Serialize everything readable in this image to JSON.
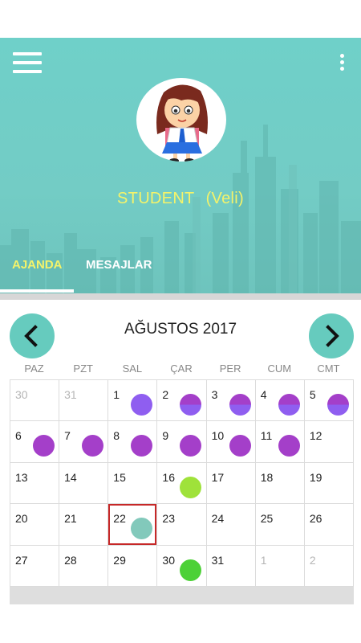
{
  "header": {
    "profile_name": "STUDENT",
    "profile_role": "(Veli)",
    "tabs": [
      {
        "label": "AJANDA",
        "active": true
      },
      {
        "label": "MESAJLAR",
        "active": false
      }
    ],
    "colors": {
      "header_bg": "#73ccc5",
      "accent_text": "#f4f36a"
    }
  },
  "calendar": {
    "month_title": "AĞUSTOS 2017",
    "prev_icon": "chevron-left-icon",
    "next_icon": "chevron-right-icon",
    "weekdays": [
      "PAZ",
      "PZT",
      "SAL",
      "ÇAR",
      "PER",
      "CUM",
      "CMT"
    ],
    "days": [
      {
        "n": "30",
        "muted": true
      },
      {
        "n": "31",
        "muted": true
      },
      {
        "n": "1",
        "dots": [
          "#8f5ef0"
        ]
      },
      {
        "n": "2",
        "dots": [
          "#a43fc9",
          "#8f5ef0"
        ]
      },
      {
        "n": "3",
        "dots": [
          "#a43fc9",
          "#8f5ef0"
        ]
      },
      {
        "n": "4",
        "dots": [
          "#a43fc9",
          "#8f5ef0"
        ]
      },
      {
        "n": "5",
        "dots": [
          "#a43fc9",
          "#8f5ef0"
        ]
      },
      {
        "n": "6",
        "dots": [
          "#a43fc9"
        ]
      },
      {
        "n": "7",
        "dots": [
          "#a43fc9"
        ]
      },
      {
        "n": "8",
        "dots": [
          "#a43fc9"
        ]
      },
      {
        "n": "9",
        "dots": [
          "#a43fc9"
        ]
      },
      {
        "n": "10",
        "dots": [
          "#a43fc9"
        ]
      },
      {
        "n": "11",
        "dots": [
          "#a43fc9"
        ]
      },
      {
        "n": "12"
      },
      {
        "n": "13"
      },
      {
        "n": "14"
      },
      {
        "n": "15"
      },
      {
        "n": "16",
        "dots": [
          "#9fe23a"
        ]
      },
      {
        "n": "17"
      },
      {
        "n": "18"
      },
      {
        "n": "19"
      },
      {
        "n": "20"
      },
      {
        "n": "21"
      },
      {
        "n": "22",
        "selected": true,
        "dots": [
          "#82c9bb"
        ]
      },
      {
        "n": "23"
      },
      {
        "n": "24"
      },
      {
        "n": "25"
      },
      {
        "n": "26"
      },
      {
        "n": "27"
      },
      {
        "n": "28"
      },
      {
        "n": "29"
      },
      {
        "n": "30",
        "dots": [
          "#4cd137"
        ]
      },
      {
        "n": "31"
      },
      {
        "n": "1",
        "muted": true
      },
      {
        "n": "2",
        "muted": true
      }
    ],
    "colors": {
      "nav_button": "#66cbbe",
      "selected_border": "#c62828"
    }
  }
}
